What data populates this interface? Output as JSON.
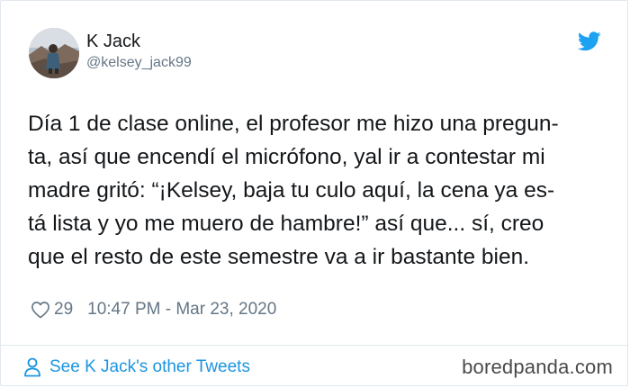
{
  "tweet": {
    "author_name": "K Jack",
    "author_handle": "@kelsey_jack99",
    "text": "Día 1 de clase online, el profesor me hizo una pregun-\nta, así que encendí el micrófono, yal ir a contestar mi\nmadre gritó: “¡Kelsey, baja tu culo aquí, la cena ya  es-\ntá lista y yo me muero de hambre!” así que... sí, creo\nque el resto de este semestre va a ir bastante bien.",
    "likes": "29",
    "timestamp": "10:47 PM - Mar 23, 2020"
  },
  "footer": {
    "other_tweets_label": "See K Jack's other Tweets"
  },
  "watermark": "boredpanda.com",
  "colors": {
    "twitter_blue": "#1da1f2",
    "link_blue": "#1b95e0",
    "text": "#14171a",
    "muted": "#657786",
    "border": "#e1e8ed"
  },
  "icons": {
    "logo": "twitter-bird-icon",
    "like": "heart-icon",
    "profile": "person-icon"
  }
}
